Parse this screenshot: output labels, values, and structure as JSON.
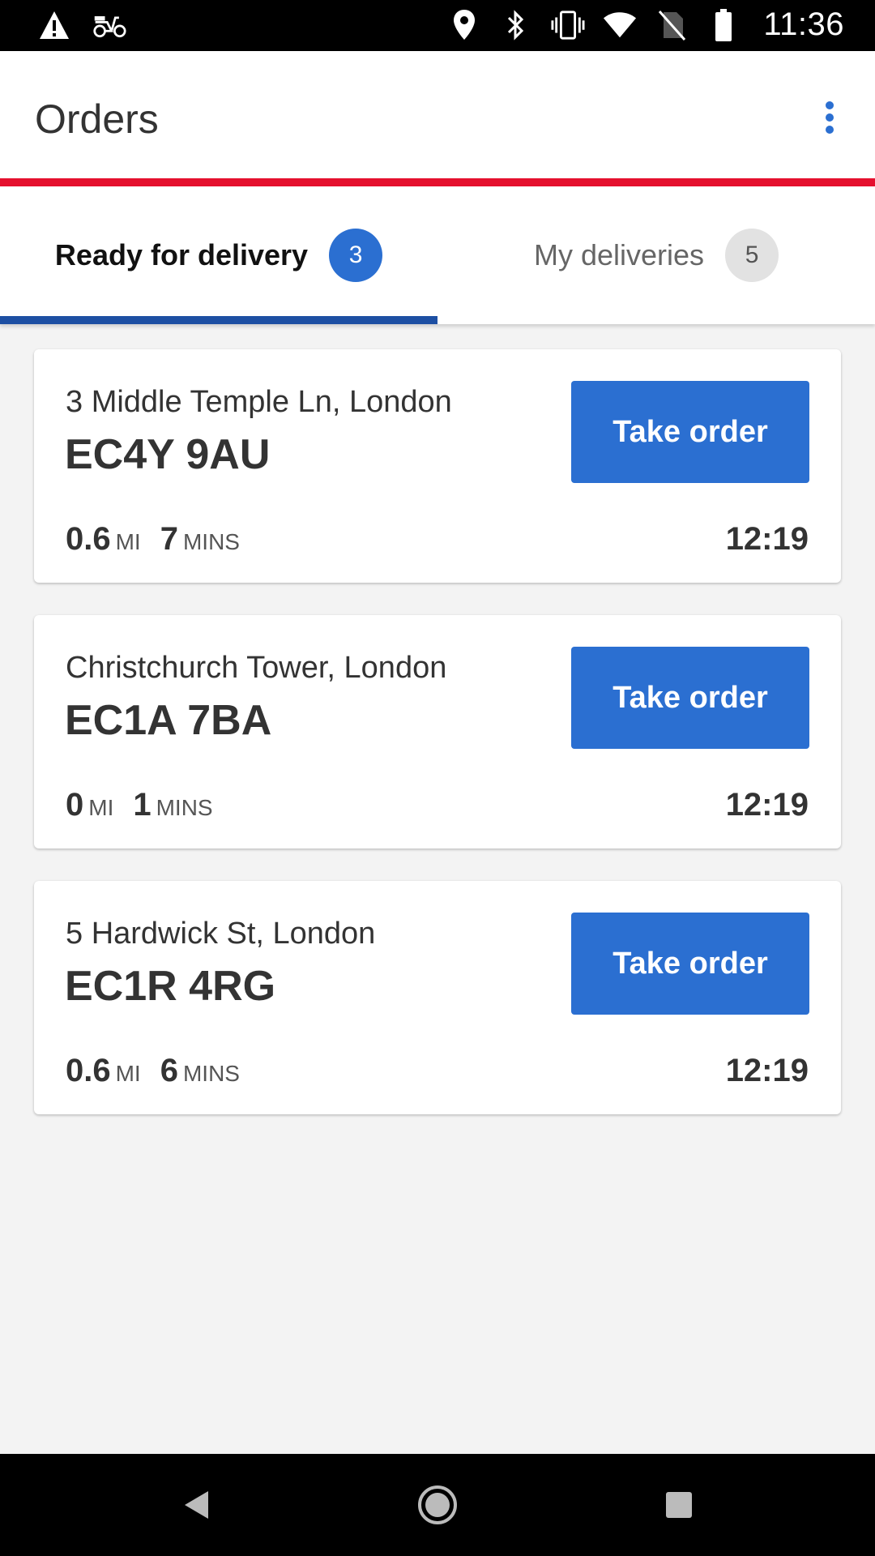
{
  "status_bar": {
    "time": "11:36",
    "left_icons": [
      "warning-icon",
      "scooter-icon"
    ],
    "right_icons": [
      "location-icon",
      "bluetooth-icon",
      "vibrate-icon",
      "wifi-icon",
      "no-sim-icon",
      "battery-icon"
    ]
  },
  "app_bar": {
    "title": "Orders",
    "menu_icon": "more-vert-icon"
  },
  "colors": {
    "accent": "#2b6fd1",
    "brand_line": "#e5102e",
    "tab_indicator": "#1d4fa3"
  },
  "tabs": [
    {
      "label": "Ready for delivery",
      "badge": "3",
      "selected": true
    },
    {
      "label": "My deliveries",
      "badge": "5",
      "selected": false
    }
  ],
  "orders": [
    {
      "address": "3 Middle Temple Ln, London",
      "postcode": "EC4Y 9AU",
      "button": "Take order",
      "distance": "0.6",
      "distance_unit": "MI",
      "duration": "7",
      "duration_unit": "MINS",
      "time": "12:19"
    },
    {
      "address": "Christchurch Tower, London",
      "postcode": "EC1A 7BA",
      "button": "Take order",
      "distance": "0",
      "distance_unit": "MI",
      "duration": "1",
      "duration_unit": "MINS",
      "time": "12:19"
    },
    {
      "address": "5 Hardwick St, London",
      "postcode": "EC1R 4RG",
      "button": "Take order",
      "distance": "0.6",
      "distance_unit": "MI",
      "duration": "6",
      "duration_unit": "MINS",
      "time": "12:19"
    }
  ],
  "nav_bar": {
    "icons": [
      "back-icon",
      "home-icon",
      "recents-icon"
    ]
  }
}
